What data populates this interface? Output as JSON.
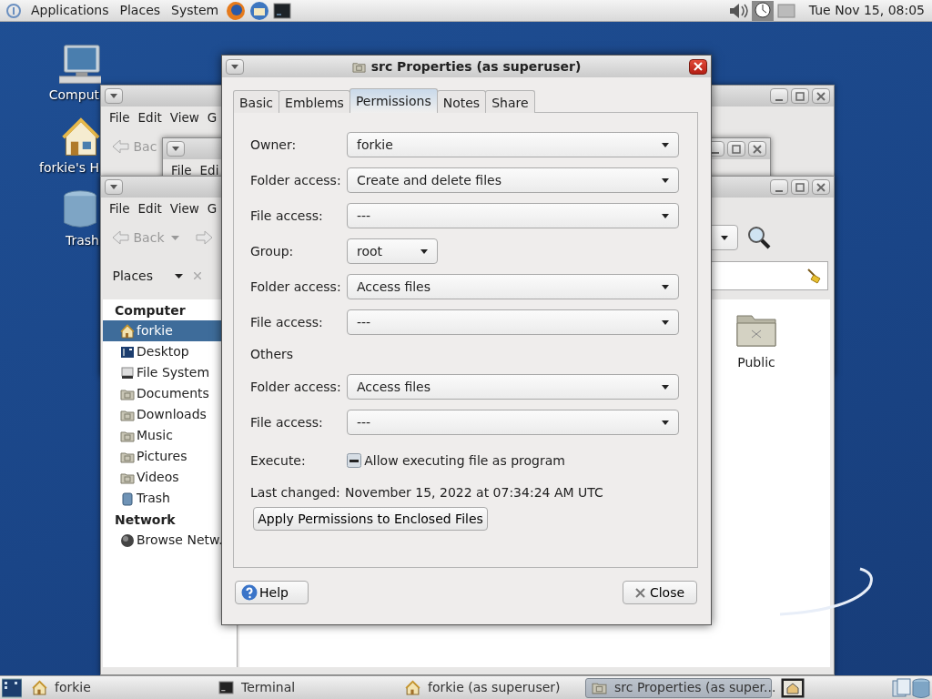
{
  "top_panel": {
    "menus": [
      "Applications",
      "Places",
      "System"
    ],
    "clock": "Tue Nov 15, 08:05"
  },
  "desktop_icons": [
    {
      "label": "Comput",
      "kind": "computer"
    },
    {
      "label": "forkie's H",
      "kind": "home"
    },
    {
      "label": "Trash",
      "kind": "trash"
    }
  ],
  "back_windows": [
    {
      "menu": [
        "File",
        "Edit",
        "View",
        "G"
      ],
      "back": "Bac"
    },
    {
      "menu": [
        "File",
        "Edi"
      ]
    }
  ],
  "file_manager": {
    "menu": [
      "File",
      "Edit",
      "View",
      "G"
    ],
    "back": "Back",
    "side_pane_title": "Places",
    "sidebar": [
      {
        "heading": "Computer",
        "items": [
          {
            "label": "forkie",
            "kind": "home",
            "selected": true
          },
          {
            "label": "Desktop",
            "kind": "desktop",
            "selected": false
          },
          {
            "label": "File System",
            "kind": "drive",
            "selected": false
          },
          {
            "label": "Documents",
            "kind": "folder",
            "selected": false
          },
          {
            "label": "Downloads",
            "kind": "folder",
            "selected": false
          },
          {
            "label": "Music",
            "kind": "folder",
            "selected": false
          },
          {
            "label": "Pictures",
            "kind": "folder",
            "selected": false
          },
          {
            "label": "Videos",
            "kind": "folder",
            "selected": false
          },
          {
            "label": "Trash",
            "kind": "trash",
            "selected": false
          }
        ]
      },
      {
        "heading": "Network",
        "items": [
          {
            "label": "Browse Netw.",
            "kind": "network",
            "selected": false
          }
        ]
      }
    ],
    "files": [
      {
        "label": "Public"
      }
    ]
  },
  "dialog": {
    "title": "src Properties (as superuser)",
    "tabs": [
      {
        "label": "Basic",
        "selected": false
      },
      {
        "label": "Emblems",
        "selected": false
      },
      {
        "label": "Permissions",
        "selected": true
      },
      {
        "label": "Notes",
        "selected": false
      },
      {
        "label": "Share",
        "selected": false
      }
    ],
    "groups": [
      [
        {
          "kind": "combo",
          "label": "Owner:",
          "value": "forkie"
        },
        {
          "kind": "combo",
          "label": "Folder access:",
          "value": "Create and delete files"
        },
        {
          "kind": "combo",
          "label": "File access:",
          "value": "---"
        }
      ],
      [
        {
          "kind": "combo_short",
          "label": "Group:",
          "value": "root"
        },
        {
          "kind": "combo",
          "label": "Folder access:",
          "value": "Access files"
        },
        {
          "kind": "combo",
          "label": "File access:",
          "value": "---"
        }
      ],
      [
        {
          "kind": "heading",
          "label": "Others"
        },
        {
          "kind": "combo",
          "label": "Folder access:",
          "value": "Access files"
        },
        {
          "kind": "combo",
          "label": "File access:",
          "value": "---"
        }
      ],
      [
        {
          "kind": "checkbox",
          "label": "Execute:",
          "text": "Allow executing file as program",
          "inconsistent": true
        },
        {
          "kind": "info",
          "label": "Last changed:",
          "value": "November 15, 2022 at 07:34:24 AM UTC"
        },
        {
          "kind": "button",
          "text": "Apply Permissions to Enclosed Files"
        }
      ]
    ],
    "help_button": "Help",
    "close_button": "Close"
  },
  "taskbar": {
    "items": [
      {
        "label": "forkie",
        "kind": "home",
        "selected": false
      },
      {
        "label": "Terminal",
        "kind": "terminal",
        "selected": false
      },
      {
        "label": "forkie (as superuser)",
        "kind": "home",
        "selected": false
      },
      {
        "label": "src Properties (as super...",
        "kind": "folder",
        "selected": true
      }
    ]
  }
}
